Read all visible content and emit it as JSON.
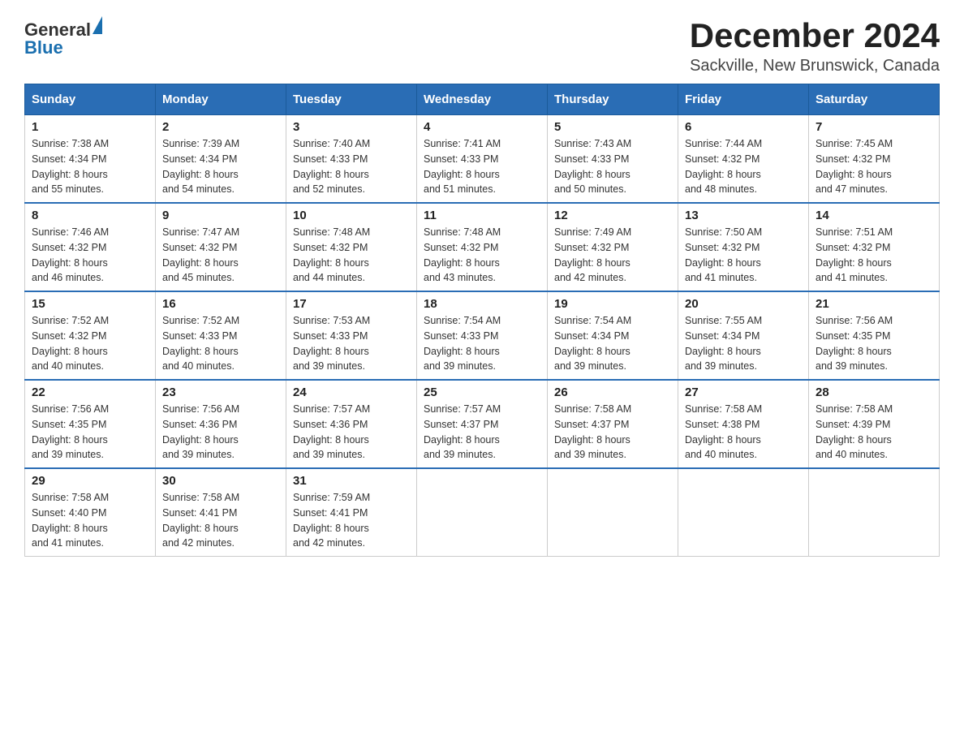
{
  "header": {
    "logo": {
      "text_general": "General",
      "text_blue": "Blue",
      "alt": "GeneralBlue logo"
    },
    "title": "December 2024",
    "subtitle": "Sackville, New Brunswick, Canada"
  },
  "weekdays": [
    "Sunday",
    "Monday",
    "Tuesday",
    "Wednesday",
    "Thursday",
    "Friday",
    "Saturday"
  ],
  "weeks": [
    [
      {
        "day": "1",
        "sunrise": "7:38 AM",
        "sunset": "4:34 PM",
        "daylight": "8 hours and 55 minutes."
      },
      {
        "day": "2",
        "sunrise": "7:39 AM",
        "sunset": "4:34 PM",
        "daylight": "8 hours and 54 minutes."
      },
      {
        "day": "3",
        "sunrise": "7:40 AM",
        "sunset": "4:33 PM",
        "daylight": "8 hours and 52 minutes."
      },
      {
        "day": "4",
        "sunrise": "7:41 AM",
        "sunset": "4:33 PM",
        "daylight": "8 hours and 51 minutes."
      },
      {
        "day": "5",
        "sunrise": "7:43 AM",
        "sunset": "4:33 PM",
        "daylight": "8 hours and 50 minutes."
      },
      {
        "day": "6",
        "sunrise": "7:44 AM",
        "sunset": "4:32 PM",
        "daylight": "8 hours and 48 minutes."
      },
      {
        "day": "7",
        "sunrise": "7:45 AM",
        "sunset": "4:32 PM",
        "daylight": "8 hours and 47 minutes."
      }
    ],
    [
      {
        "day": "8",
        "sunrise": "7:46 AM",
        "sunset": "4:32 PM",
        "daylight": "8 hours and 46 minutes."
      },
      {
        "day": "9",
        "sunrise": "7:47 AM",
        "sunset": "4:32 PM",
        "daylight": "8 hours and 45 minutes."
      },
      {
        "day": "10",
        "sunrise": "7:48 AM",
        "sunset": "4:32 PM",
        "daylight": "8 hours and 44 minutes."
      },
      {
        "day": "11",
        "sunrise": "7:48 AM",
        "sunset": "4:32 PM",
        "daylight": "8 hours and 43 minutes."
      },
      {
        "day": "12",
        "sunrise": "7:49 AM",
        "sunset": "4:32 PM",
        "daylight": "8 hours and 42 minutes."
      },
      {
        "day": "13",
        "sunrise": "7:50 AM",
        "sunset": "4:32 PM",
        "daylight": "8 hours and 41 minutes."
      },
      {
        "day": "14",
        "sunrise": "7:51 AM",
        "sunset": "4:32 PM",
        "daylight": "8 hours and 41 minutes."
      }
    ],
    [
      {
        "day": "15",
        "sunrise": "7:52 AM",
        "sunset": "4:32 PM",
        "daylight": "8 hours and 40 minutes."
      },
      {
        "day": "16",
        "sunrise": "7:52 AM",
        "sunset": "4:33 PM",
        "daylight": "8 hours and 40 minutes."
      },
      {
        "day": "17",
        "sunrise": "7:53 AM",
        "sunset": "4:33 PM",
        "daylight": "8 hours and 39 minutes."
      },
      {
        "day": "18",
        "sunrise": "7:54 AM",
        "sunset": "4:33 PM",
        "daylight": "8 hours and 39 minutes."
      },
      {
        "day": "19",
        "sunrise": "7:54 AM",
        "sunset": "4:34 PM",
        "daylight": "8 hours and 39 minutes."
      },
      {
        "day": "20",
        "sunrise": "7:55 AM",
        "sunset": "4:34 PM",
        "daylight": "8 hours and 39 minutes."
      },
      {
        "day": "21",
        "sunrise": "7:56 AM",
        "sunset": "4:35 PM",
        "daylight": "8 hours and 39 minutes."
      }
    ],
    [
      {
        "day": "22",
        "sunrise": "7:56 AM",
        "sunset": "4:35 PM",
        "daylight": "8 hours and 39 minutes."
      },
      {
        "day": "23",
        "sunrise": "7:56 AM",
        "sunset": "4:36 PM",
        "daylight": "8 hours and 39 minutes."
      },
      {
        "day": "24",
        "sunrise": "7:57 AM",
        "sunset": "4:36 PM",
        "daylight": "8 hours and 39 minutes."
      },
      {
        "day": "25",
        "sunrise": "7:57 AM",
        "sunset": "4:37 PM",
        "daylight": "8 hours and 39 minutes."
      },
      {
        "day": "26",
        "sunrise": "7:58 AM",
        "sunset": "4:37 PM",
        "daylight": "8 hours and 39 minutes."
      },
      {
        "day": "27",
        "sunrise": "7:58 AM",
        "sunset": "4:38 PM",
        "daylight": "8 hours and 40 minutes."
      },
      {
        "day": "28",
        "sunrise": "7:58 AM",
        "sunset": "4:39 PM",
        "daylight": "8 hours and 40 minutes."
      }
    ],
    [
      {
        "day": "29",
        "sunrise": "7:58 AM",
        "sunset": "4:40 PM",
        "daylight": "8 hours and 41 minutes."
      },
      {
        "day": "30",
        "sunrise": "7:58 AM",
        "sunset": "4:41 PM",
        "daylight": "8 hours and 42 minutes."
      },
      {
        "day": "31",
        "sunrise": "7:59 AM",
        "sunset": "4:41 PM",
        "daylight": "8 hours and 42 minutes."
      },
      null,
      null,
      null,
      null
    ]
  ],
  "labels": {
    "sunrise": "Sunrise:",
    "sunset": "Sunset:",
    "daylight": "Daylight:"
  }
}
